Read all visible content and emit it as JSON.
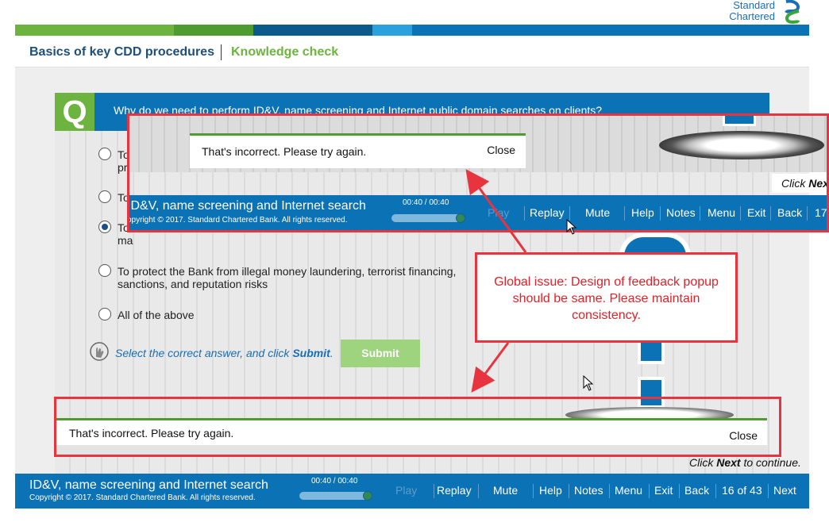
{
  "logo": {
    "line1": "Standard",
    "line2": "Chartered"
  },
  "header": {
    "course_title": "Basics of key CDD procedures",
    "section": "Knowledge check"
  },
  "question": {
    "badge": "Q",
    "text": "Why do we need to perform ID&V, name screening and Internet public domain searches on clients?",
    "options": [
      {
        "text_line1": "To",
        "text_line2": "pr",
        "selected": false
      },
      {
        "text_line1": "To",
        "text_line2": "",
        "selected": false
      },
      {
        "text_line1": "To",
        "text_line2": "ma",
        "selected": true
      },
      {
        "text_line1": "To protect the Bank from illegal money laundering, terrorist financing,",
        "text_line2": "sanctions, and reputation risks",
        "selected": false
      },
      {
        "text_line1": "All of the above",
        "text_line2": "",
        "selected": false
      }
    ],
    "hint_prefix": "Select the correct answer, and click ",
    "hint_bold": "Submit",
    "hint_suffix": ".",
    "submit_label": "Submit"
  },
  "feedback_bottom": {
    "message": "That's incorrect. Please try again.",
    "close_label": "Close"
  },
  "click_next": {
    "prefix": "Click ",
    "bold": "Next",
    "suffix": " to continue."
  },
  "nav": {
    "title": "ID&V, name screening and Internet search",
    "copyright": "Copyright © 2017. Standard Chartered Bank. All rights reserved.",
    "timer": "00:40 / 00:40",
    "progress": 1.0,
    "buttons": {
      "play": "Play",
      "replay": "Replay",
      "mute": "Mute",
      "help": "Help",
      "notes": "Notes",
      "menu": "Menu",
      "exit": "Exit",
      "back": "Back",
      "page": "16 of 43",
      "next": "Next"
    }
  },
  "overlay": {
    "feedback_message": "That's incorrect. Please try again.",
    "close_label": "Close",
    "click_prefix": "Click ",
    "click_bold": "Nex",
    "nav_title": "ID&V, name screening and Internet search",
    "nav_copyright": "opyright © 2017. Standard Chartered Bank. All rights reserved.",
    "timer": "00:40 / 00:40",
    "buttons": {
      "play": "Play",
      "replay": "Replay",
      "mute": "Mute",
      "help": "Help",
      "notes": "Notes",
      "menu": "Menu",
      "exit": "Exit",
      "back": "Back",
      "page": "17"
    }
  },
  "callout": {
    "text": "Global issue: Design of feedback popup should be same. Please maintain consistency."
  },
  "colors": {
    "brand_blue": "#0a72b5",
    "brand_green": "#6db33f",
    "annotation_red": "#e8343f"
  }
}
